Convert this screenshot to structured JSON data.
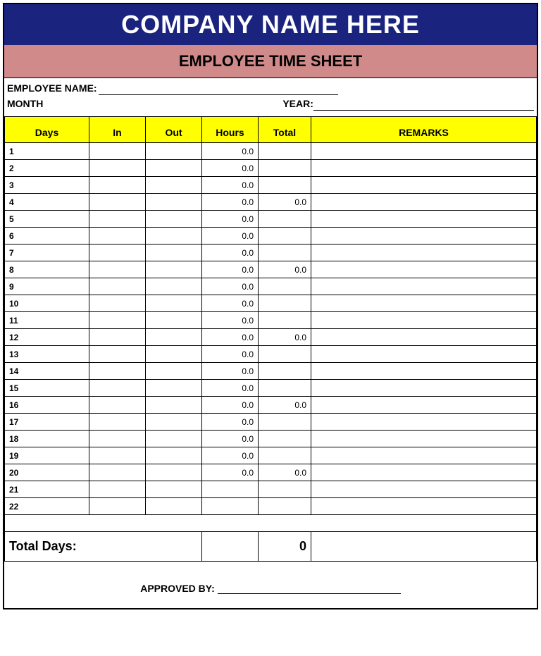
{
  "header": {
    "company": "COMPANY NAME HERE",
    "title": "EMPLOYEE TIME SHEET"
  },
  "info": {
    "employee_label": "EMPLOYEE NAME:",
    "month_label": "MONTH",
    "year_label": "YEAR:"
  },
  "columns": {
    "days": "Days",
    "in": "In",
    "out": "Out",
    "hours": "Hours",
    "total": "Total",
    "remarks": "REMARKS"
  },
  "rows": [
    {
      "day": "1",
      "in": "",
      "out": "",
      "hours": "0.0",
      "total": "",
      "remarks": ""
    },
    {
      "day": "2",
      "in": "",
      "out": "",
      "hours": "0.0",
      "total": "",
      "remarks": ""
    },
    {
      "day": "3",
      "in": "",
      "out": "",
      "hours": "0.0",
      "total": "",
      "remarks": ""
    },
    {
      "day": "4",
      "in": "",
      "out": "",
      "hours": "0.0",
      "total": "0.0",
      "remarks": ""
    },
    {
      "day": "5",
      "in": "",
      "out": "",
      "hours": "0.0",
      "total": "",
      "remarks": ""
    },
    {
      "day": "6",
      "in": "",
      "out": "",
      "hours": "0.0",
      "total": "",
      "remarks": ""
    },
    {
      "day": "7",
      "in": "",
      "out": "",
      "hours": "0.0",
      "total": "",
      "remarks": ""
    },
    {
      "day": "8",
      "in": "",
      "out": "",
      "hours": "0.0",
      "total": "0.0",
      "remarks": ""
    },
    {
      "day": "9",
      "in": "",
      "out": "",
      "hours": "0.0",
      "total": "",
      "remarks": ""
    },
    {
      "day": "10",
      "in": "",
      "out": "",
      "hours": "0.0",
      "total": "",
      "remarks": ""
    },
    {
      "day": "11",
      "in": "",
      "out": "",
      "hours": "0.0",
      "total": "",
      "remarks": ""
    },
    {
      "day": "12",
      "in": "",
      "out": "",
      "hours": "0.0",
      "total": "0.0",
      "remarks": ""
    },
    {
      "day": "13",
      "in": "",
      "out": "",
      "hours": "0.0",
      "total": "",
      "remarks": ""
    },
    {
      "day": "14",
      "in": "",
      "out": "",
      "hours": "0.0",
      "total": "",
      "remarks": ""
    },
    {
      "day": "15",
      "in": "",
      "out": "",
      "hours": "0.0",
      "total": "",
      "remarks": ""
    },
    {
      "day": "16",
      "in": "",
      "out": "",
      "hours": "0.0",
      "total": "0.0",
      "remarks": ""
    },
    {
      "day": "17",
      "in": "",
      "out": "",
      "hours": "0.0",
      "total": "",
      "remarks": ""
    },
    {
      "day": "18",
      "in": "",
      "out": "",
      "hours": "0.0",
      "total": "",
      "remarks": ""
    },
    {
      "day": "19",
      "in": "",
      "out": "",
      "hours": "0.0",
      "total": "",
      "remarks": ""
    },
    {
      "day": "20",
      "in": "",
      "out": "",
      "hours": "0.0",
      "total": "0.0",
      "remarks": ""
    },
    {
      "day": "21",
      "in": "",
      "out": "",
      "hours": "",
      "total": "",
      "remarks": ""
    },
    {
      "day": "22",
      "in": "",
      "out": "",
      "hours": "",
      "total": "",
      "remarks": ""
    }
  ],
  "totals": {
    "label": "Total Days:",
    "value": "0"
  },
  "footer": {
    "approved_label": "APPROVED BY:"
  }
}
